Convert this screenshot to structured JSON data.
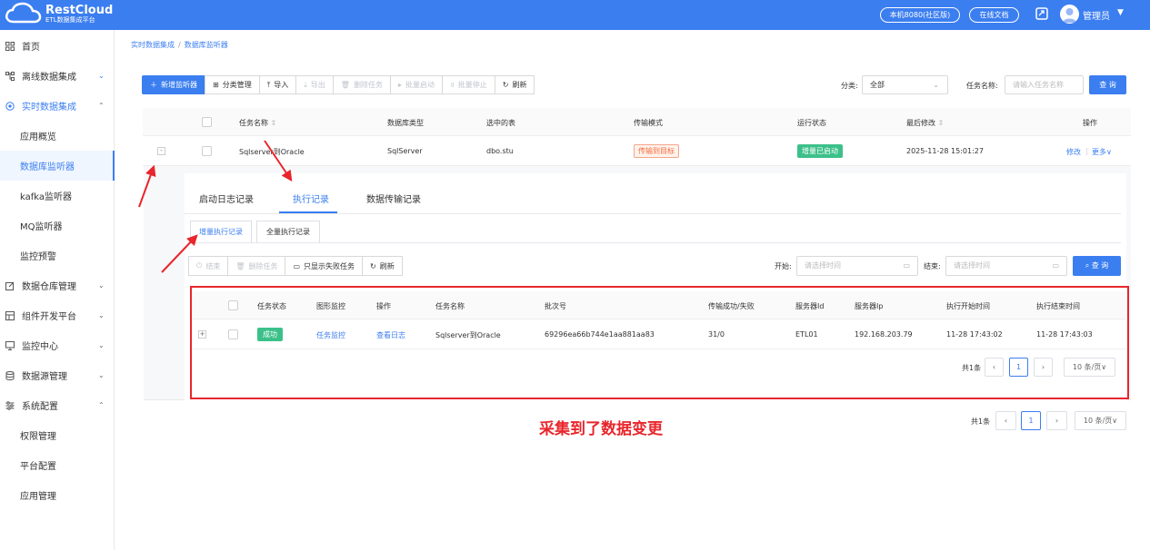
{
  "header": {
    "logo_title": "RestCloud",
    "logo_subtitle": "ETL数据集成平台",
    "env_button": "本机8080(社区版)",
    "docs_button": "在线文档",
    "user_name": "管理员"
  },
  "sidebar": {
    "items": [
      {
        "label": "首页",
        "icon": "grid-icon"
      },
      {
        "label": "离线数据集成",
        "icon": "sitemap-icon",
        "arrow": "⌄"
      },
      {
        "label": "实时数据集成",
        "icon": "target-icon",
        "arrow": "⌃"
      },
      {
        "label": "应用概览"
      },
      {
        "label": "数据库监听器"
      },
      {
        "label": "kafka监听器"
      },
      {
        "label": "MQ监听器"
      },
      {
        "label": "监控预警"
      },
      {
        "label": "数据仓库管理",
        "icon": "edit-icon",
        "arrow": "⌄"
      },
      {
        "label": "组件开发平台",
        "icon": "component-icon",
        "arrow": "⌄"
      },
      {
        "label": "监控中心",
        "icon": "monitor-icon",
        "arrow": "⌄"
      },
      {
        "label": "数据源管理",
        "icon": "database-icon",
        "arrow": "⌄"
      },
      {
        "label": "系统配置",
        "icon": "settings-icon",
        "arrow": "⌃"
      },
      {
        "label": "权限管理"
      },
      {
        "label": "平台配置"
      },
      {
        "label": "应用管理"
      }
    ]
  },
  "breadcrumb": {
    "root": "实时数据集成",
    "sep": "/",
    "current": "数据库监听器"
  },
  "toolbar": {
    "buttons": [
      {
        "label": "新增监听器",
        "glyph": "＋"
      },
      {
        "label": "分类管理",
        "glyph": "⊞"
      },
      {
        "label": "导入",
        "glyph": "⤒"
      },
      {
        "label": "导出",
        "glyph": "⤓"
      },
      {
        "label": "删除任务",
        "glyph": "🗑"
      },
      {
        "label": "批量启动",
        "glyph": "▸"
      },
      {
        "label": "批量停止",
        "glyph": "॥"
      },
      {
        "label": "刷新",
        "glyph": "↻"
      }
    ],
    "category_label": "分类:",
    "category_value": "全部",
    "task_name_label": "任务名称:",
    "task_name_placeholder": "请输入任务名称",
    "query_button": "查 询"
  },
  "main_table": {
    "headers": [
      "任务名称",
      "数据库类型",
      "选中的表",
      "传输模式",
      "运行状态",
      "最后修改",
      "操作"
    ],
    "row": {
      "expand": "-",
      "name": "Sqlserver到Oracle",
      "db_type": "SqlServer",
      "table": "dbo.stu",
      "mode": "传输到目标",
      "status": "增量已启动",
      "modified": "2025-11-28 15:01:27",
      "edit": "修改",
      "more": "更多∨"
    }
  },
  "detail": {
    "tabs": [
      "启动日志记录",
      "执行记录",
      "数据传输记录"
    ],
    "subtabs": [
      "增量执行记录",
      "全量执行记录"
    ],
    "inner_buttons": [
      {
        "label": "结束",
        "glyph": "⏻"
      },
      {
        "label": "删除任务",
        "glyph": "🗑"
      },
      {
        "label": "只显示失败任务",
        "glyph": "▭"
      },
      {
        "label": "刷新",
        "glyph": "↻"
      }
    ],
    "start_label": "开始:",
    "end_label": "结束:",
    "time_placeholder": "请选择时间",
    "query_button": "查 询",
    "headers": [
      "任务状态",
      "图形监控",
      "操作",
      "任务名称",
      "批次号",
      "传输成功/失败",
      "服务器Id",
      "服务器Ip",
      "执行开始时间",
      "执行结束时间"
    ],
    "row": {
      "expand": "+",
      "status": "成功",
      "monitor": "任务监控",
      "action": "查看日志",
      "name": "Sqlserver到Oracle",
      "batch": "69296ea66b744e1aa881aa83",
      "count": "31/0",
      "server_id": "ETL01",
      "server_ip": "192.168.203.79",
      "start": "11-28 17:43:02",
      "end": "11-28 17:43:03"
    },
    "pagination": {
      "total": "共1条",
      "page": "1",
      "size": "10 条/页∨"
    }
  },
  "outer_pagination": {
    "total": "共1条",
    "page": "1",
    "size": "10 条/页∨"
  },
  "annotation": "采集到了数据变更",
  "colors": {
    "primary": "#3b7ef0",
    "annotation_red": "#e8262c",
    "success": "#3cc08a"
  }
}
